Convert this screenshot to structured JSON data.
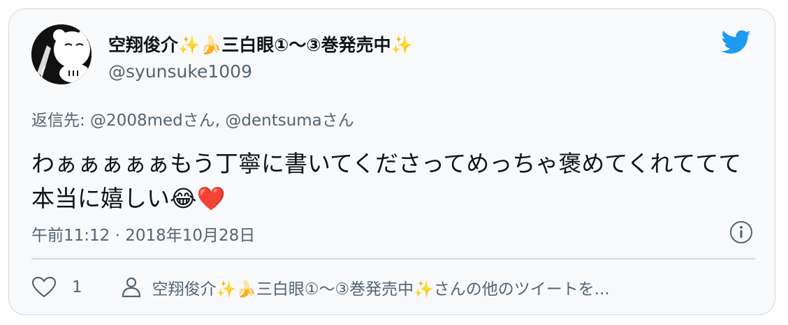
{
  "tweet": {
    "display_name": "空翔俊介✨🍌三白眼①〜③巻発売中✨",
    "handle": "@syunsuke1009",
    "reply_to": "返信先: @2008medさん, @dentsumaさん",
    "text": "わぁぁぁぁぁもう丁寧に書いてくださってめっちゃ褒めてくれててて本当に嬉しい😂❤️",
    "timestamp": "午前11:12 · 2018年10月28日",
    "like_count": "1",
    "profile_link": "空翔俊介✨🍌三白眼①〜③巻発売中✨さんの他のツイートを..."
  },
  "icons": {
    "bird": "twitter-bird-icon",
    "info": "info-icon",
    "like": "heart-icon",
    "profile": "person-icon"
  },
  "colors": {
    "brand": "#1d9bf0",
    "secondary_text": "#536471",
    "card_background": "#f7f9fa",
    "border": "#cfd9de"
  }
}
